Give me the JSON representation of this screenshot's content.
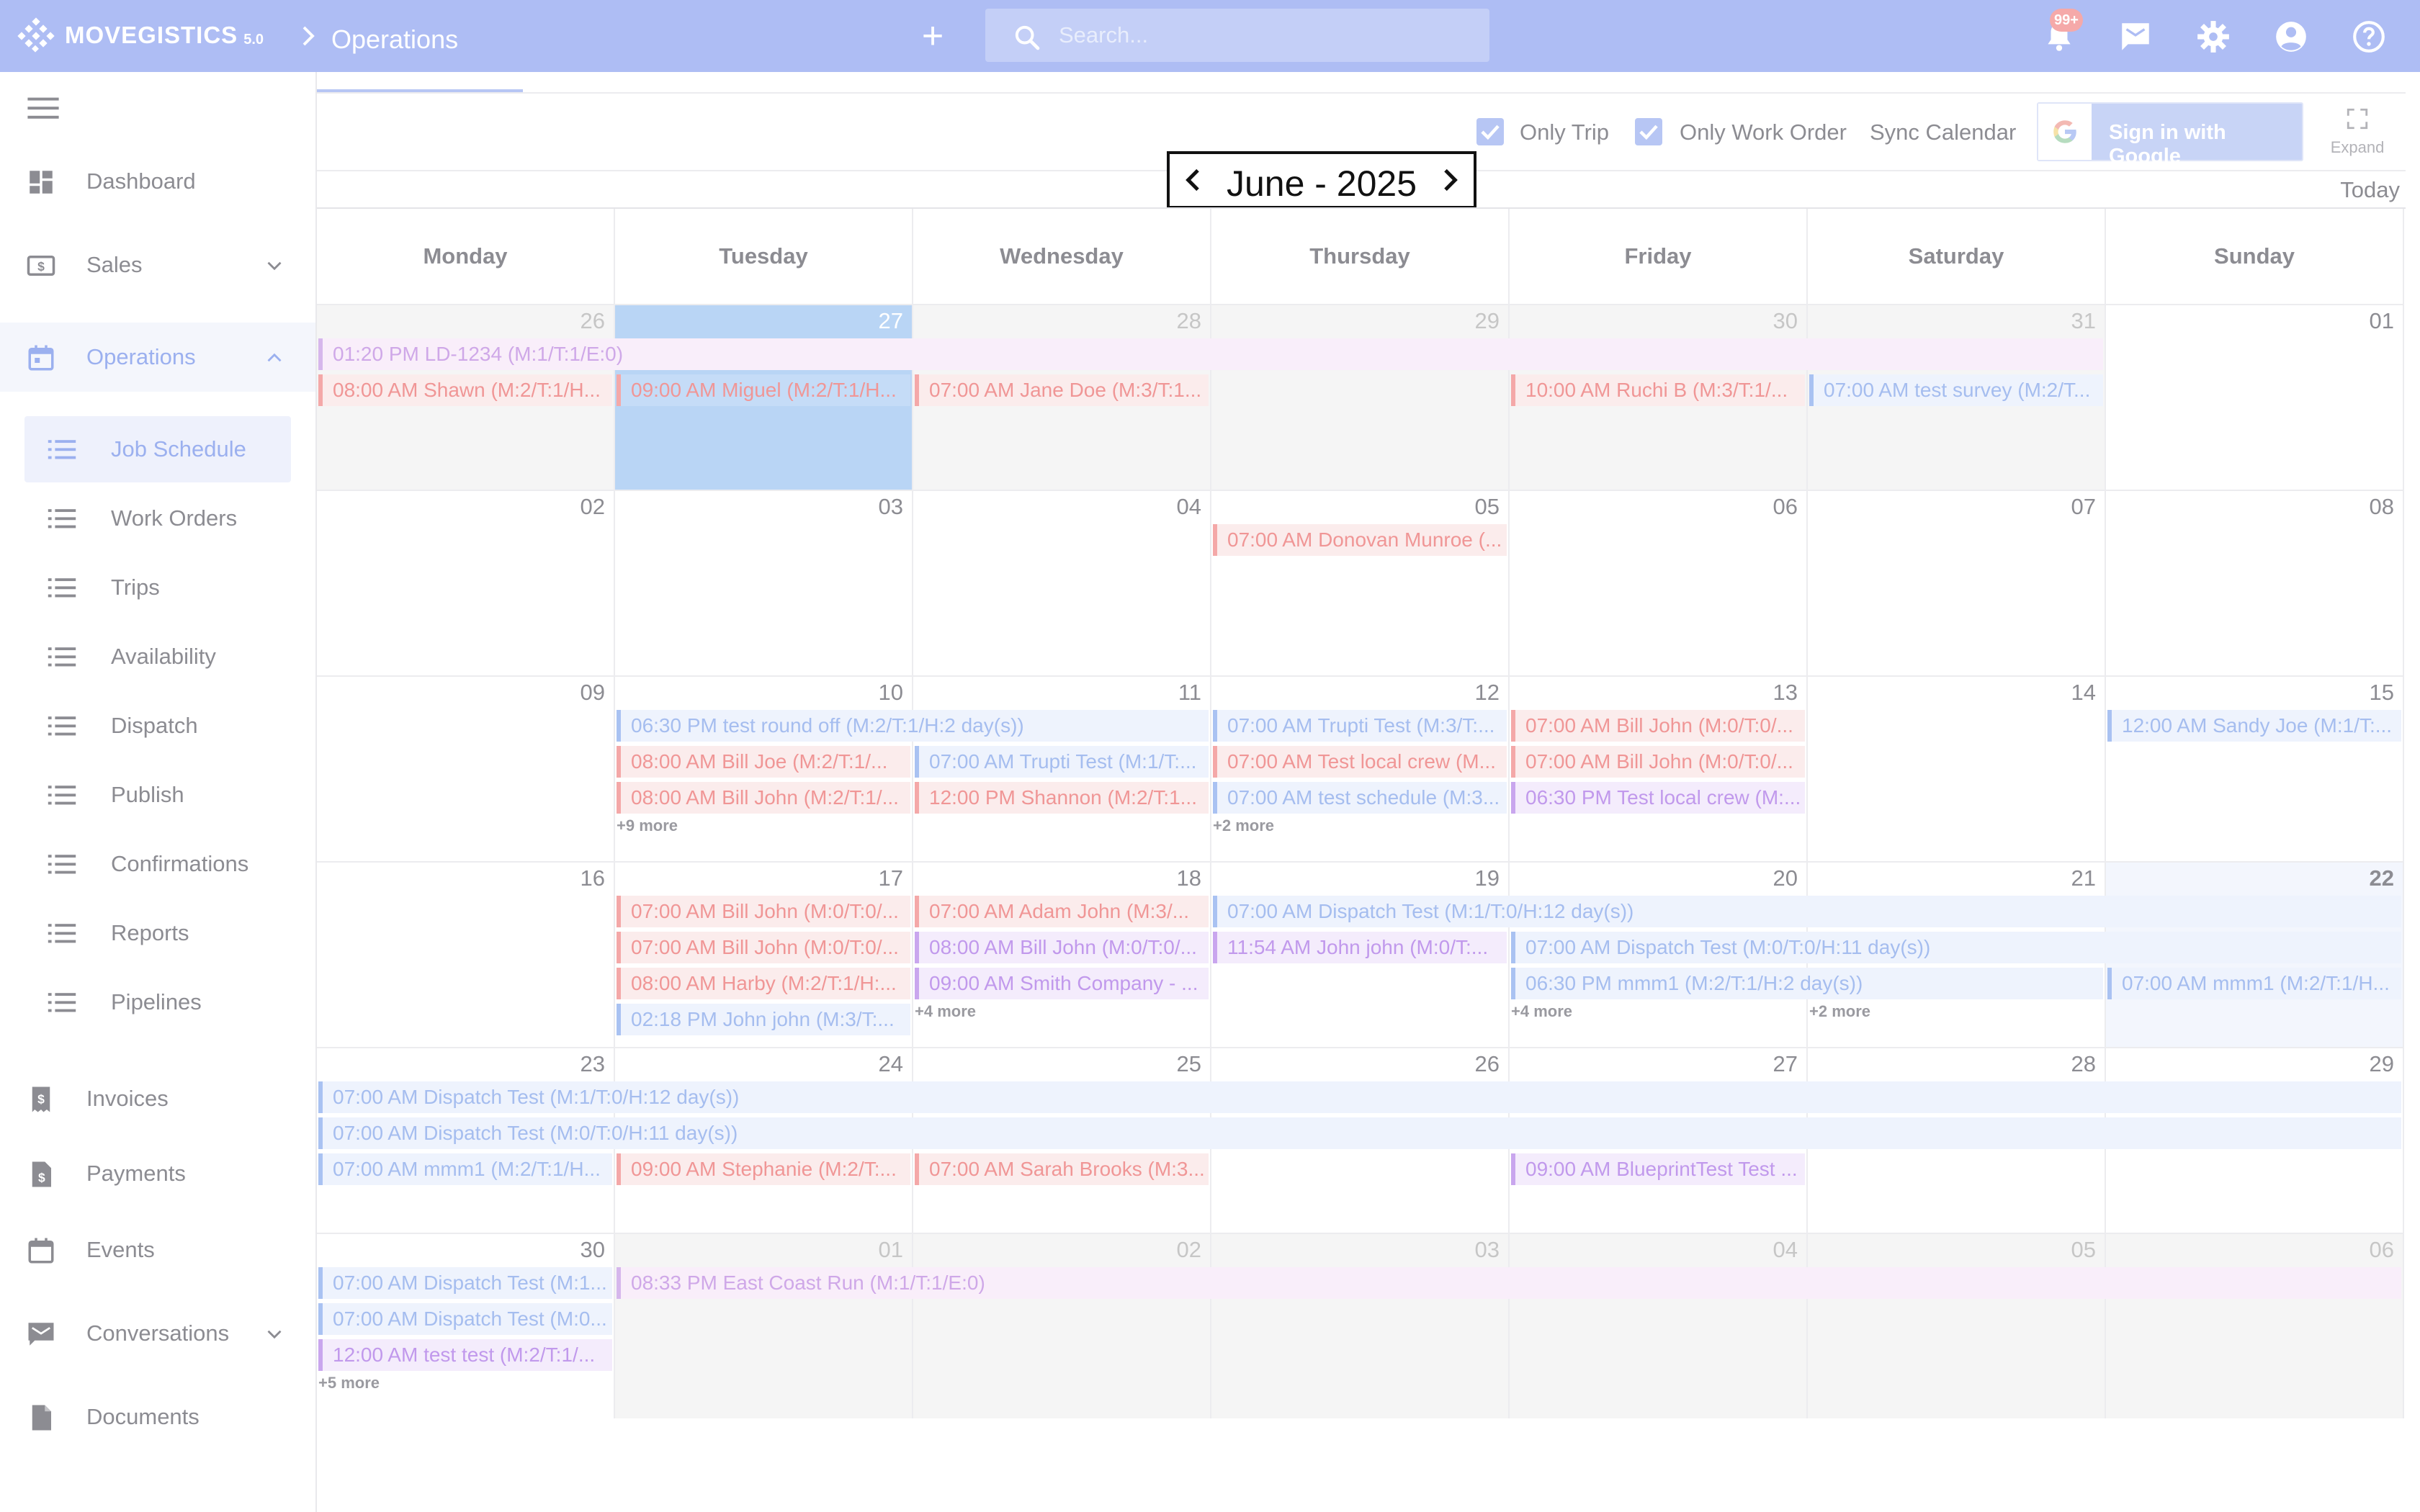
{
  "app": {
    "logo_text": "MOVEGISTICS",
    "version": "5.0",
    "breadcrumb": "Operations"
  },
  "header": {
    "search_placeholder": "Search...",
    "notification_badge": "99+"
  },
  "sidebar": {
    "dashboard": "Dashboard",
    "sales": "Sales",
    "operations": "Operations",
    "operations_items": [
      "Job Schedule",
      "Work Orders",
      "Trips",
      "Availability",
      "Dispatch",
      "Publish",
      "Confirmations",
      "Reports",
      "Pipelines"
    ],
    "invoices": "Invoices",
    "payments": "Payments",
    "events": "Events",
    "conversations": "Conversations",
    "documents": "Documents"
  },
  "toolbar": {
    "only_trip": "Only Trip",
    "only_work_order": "Only Work Order",
    "sync_calendar": "Sync Calendar",
    "google_signin": "Sign in with Google",
    "expand": "Expand",
    "today": "Today"
  },
  "calendar": {
    "month_label": "June - 2025",
    "weekdays": [
      "Monday",
      "Tuesday",
      "Wednesday",
      "Thursday",
      "Friday",
      "Saturday",
      "Sunday"
    ],
    "weeks": [
      [
        "26",
        "27",
        "28",
        "29",
        "30",
        "31",
        "01"
      ],
      [
        "02",
        "03",
        "04",
        "05",
        "06",
        "07",
        "08"
      ],
      [
        "09",
        "10",
        "11",
        "12",
        "13",
        "14",
        "15"
      ],
      [
        "16",
        "17",
        "18",
        "19",
        "20",
        "21",
        "22"
      ],
      [
        "23",
        "24",
        "25",
        "26",
        "27",
        "28",
        "29"
      ],
      [
        "30",
        "01",
        "02",
        "03",
        "04",
        "05",
        "06"
      ]
    ],
    "other_month_cells": [
      "0-0",
      "0-1",
      "0-2",
      "0-3",
      "0-4",
      "0-5",
      "5-1",
      "5-2",
      "5-3",
      "5-4",
      "5-5",
      "5-6"
    ],
    "highlight_cell": "0-1",
    "bold_cell": "3-6",
    "weekend_tint_cells": [
      "3-6"
    ],
    "colors": {
      "pink": "#f4a8a8",
      "blue": "#a9c2f2",
      "purple": "#c9a6ee",
      "lilac": "#d6b7ec"
    },
    "events": [
      {
        "w": 0,
        "d": 0,
        "span": 6,
        "lane": 0,
        "color": "lilac",
        "text": "01:20 PM LD-1234 (M:1/T:1/E:0)"
      },
      {
        "w": 0,
        "d": 0,
        "span": 1,
        "lane": 1,
        "color": "pink",
        "text": "08:00 AM Shawn (M:2/T:1/H..."
      },
      {
        "w": 0,
        "d": 1,
        "span": 1,
        "lane": 1,
        "color": "pink",
        "text": "09:00 AM Miguel (M:2/T:1/H..."
      },
      {
        "w": 0,
        "d": 2,
        "span": 1,
        "lane": 1,
        "color": "pink",
        "text": "07:00 AM Jane Doe (M:3/T:1..."
      },
      {
        "w": 0,
        "d": 4,
        "span": 1,
        "lane": 1,
        "color": "pink",
        "text": "10:00 AM Ruchi B (M:3/T:1/..."
      },
      {
        "w": 0,
        "d": 5,
        "span": 1,
        "lane": 1,
        "color": "blue",
        "text": "07:00 AM test survey (M:2/T..."
      },
      {
        "w": 1,
        "d": 3,
        "span": 1,
        "lane": 0,
        "color": "pink",
        "text": "07:00 AM Donovan Munroe (..."
      },
      {
        "w": 2,
        "d": 1,
        "span": 2,
        "lane": 0,
        "color": "blue",
        "text": "06:30 PM test round off (M:2/T:1/H:2 day(s))"
      },
      {
        "w": 2,
        "d": 3,
        "span": 1,
        "lane": 0,
        "color": "blue",
        "text": "07:00 AM Trupti Test (M:3/T:..."
      },
      {
        "w": 2,
        "d": 4,
        "span": 1,
        "lane": 0,
        "color": "pink",
        "text": "07:00 AM Bill John (M:0/T:0/..."
      },
      {
        "w": 2,
        "d": 6,
        "span": 1,
        "lane": 0,
        "color": "blue",
        "text": "12:00 AM Sandy Joe (M:1/T:..."
      },
      {
        "w": 2,
        "d": 1,
        "span": 1,
        "lane": 1,
        "color": "pink",
        "text": "08:00 AM Bill Joe (M:2/T:1/..."
      },
      {
        "w": 2,
        "d": 2,
        "span": 1,
        "lane": 1,
        "color": "blue",
        "text": "07:00 AM Trupti Test (M:1/T:..."
      },
      {
        "w": 2,
        "d": 3,
        "span": 1,
        "lane": 1,
        "color": "pink",
        "text": "07:00 AM Test local crew (M..."
      },
      {
        "w": 2,
        "d": 4,
        "span": 1,
        "lane": 1,
        "color": "pink",
        "text": "07:00 AM Bill John (M:0/T:0/..."
      },
      {
        "w": 2,
        "d": 1,
        "span": 1,
        "lane": 2,
        "color": "pink",
        "text": "08:00 AM Bill John (M:2/T:1/..."
      },
      {
        "w": 2,
        "d": 2,
        "span": 1,
        "lane": 2,
        "color": "pink",
        "text": "12:00 PM Shannon (M:2/T:1..."
      },
      {
        "w": 2,
        "d": 3,
        "span": 1,
        "lane": 2,
        "color": "blue",
        "text": "07:00 AM test schedule (M:3..."
      },
      {
        "w": 2,
        "d": 4,
        "span": 1,
        "lane": 2,
        "color": "purple",
        "text": "06:30 PM Test local crew (M:..."
      },
      {
        "w": 3,
        "d": 1,
        "span": 1,
        "lane": 0,
        "color": "pink",
        "text": "07:00 AM Bill John (M:0/T:0/..."
      },
      {
        "w": 3,
        "d": 2,
        "span": 1,
        "lane": 0,
        "color": "pink",
        "text": "07:00 AM Adam John (M:3/..."
      },
      {
        "w": 3,
        "d": 3,
        "span": 4,
        "lane": 0,
        "color": "blue",
        "text": "07:00 AM Dispatch Test (M:1/T:0/H:12 day(s))"
      },
      {
        "w": 3,
        "d": 1,
        "span": 1,
        "lane": 1,
        "color": "pink",
        "text": "07:00 AM Bill John (M:0/T:0/..."
      },
      {
        "w": 3,
        "d": 2,
        "span": 1,
        "lane": 1,
        "color": "purple",
        "text": "08:00 AM Bill John (M:0/T:0/..."
      },
      {
        "w": 3,
        "d": 3,
        "span": 1,
        "lane": 1,
        "color": "purple",
        "text": "11:54 AM John john (M:0/T:..."
      },
      {
        "w": 3,
        "d": 4,
        "span": 3,
        "lane": 1,
        "color": "blue",
        "text": "07:00 AM Dispatch Test (M:0/T:0/H:11 day(s))"
      },
      {
        "w": 3,
        "d": 1,
        "span": 1,
        "lane": 2,
        "color": "pink",
        "text": "08:00 AM Harby (M:2/T:1/H:..."
      },
      {
        "w": 3,
        "d": 2,
        "span": 1,
        "lane": 2,
        "color": "purple",
        "text": "09:00 AM Smith Company - ..."
      },
      {
        "w": 3,
        "d": 4,
        "span": 2,
        "lane": 2,
        "color": "blue",
        "text": "06:30 PM mmm1 (M:2/T:1/H:2 day(s))"
      },
      {
        "w": 3,
        "d": 6,
        "span": 1,
        "lane": 2,
        "color": "blue",
        "text": "07:00 AM mmm1 (M:2/T:1/H..."
      },
      {
        "w": 3,
        "d": 1,
        "span": 1,
        "lane": 3,
        "color": "blue",
        "text": "02:18 PM John john (M:3/T:..."
      },
      {
        "w": 4,
        "d": 0,
        "span": 7,
        "lane": 0,
        "color": "blue",
        "text": "07:00 AM Dispatch Test (M:1/T:0/H:12 day(s))"
      },
      {
        "w": 4,
        "d": 0,
        "span": 7,
        "lane": 1,
        "color": "blue",
        "text": "07:00 AM Dispatch Test (M:0/T:0/H:11 day(s))"
      },
      {
        "w": 4,
        "d": 0,
        "span": 1,
        "lane": 2,
        "color": "blue",
        "text": "07:00 AM mmm1 (M:2/T:1/H..."
      },
      {
        "w": 4,
        "d": 1,
        "span": 1,
        "lane": 2,
        "color": "pink",
        "text": "09:00 AM Stephanie (M:2/T:..."
      },
      {
        "w": 4,
        "d": 2,
        "span": 1,
        "lane": 2,
        "color": "pink",
        "text": "07:00 AM Sarah Brooks (M:3..."
      },
      {
        "w": 4,
        "d": 4,
        "span": 1,
        "lane": 2,
        "color": "purple",
        "text": "09:00 AM BlueprintTest Test ..."
      },
      {
        "w": 5,
        "d": 0,
        "span": 1,
        "lane": 0,
        "color": "blue",
        "text": "07:00 AM Dispatch Test (M:1..."
      },
      {
        "w": 5,
        "d": 1,
        "span": 6,
        "lane": 0,
        "color": "lilac",
        "text": "08:33 PM East Coast Run (M:1/T:1/E:0)"
      },
      {
        "w": 5,
        "d": 0,
        "span": 1,
        "lane": 1,
        "color": "blue",
        "text": "07:00 AM Dispatch Test (M:0..."
      },
      {
        "w": 5,
        "d": 0,
        "span": 1,
        "lane": 2,
        "color": "purple",
        "text": "12:00 AM test test (M:2/T:1/..."
      }
    ],
    "more_links": [
      {
        "w": 2,
        "d": 1,
        "text": "+9 more"
      },
      {
        "w": 2,
        "d": 3,
        "text": "+2 more"
      },
      {
        "w": 3,
        "d": 2,
        "text": "+4 more"
      },
      {
        "w": 3,
        "d": 4,
        "text": "+4 more"
      },
      {
        "w": 3,
        "d": 5,
        "text": "+2 more"
      },
      {
        "w": 5,
        "d": 0,
        "text": "+5 more"
      }
    ]
  }
}
